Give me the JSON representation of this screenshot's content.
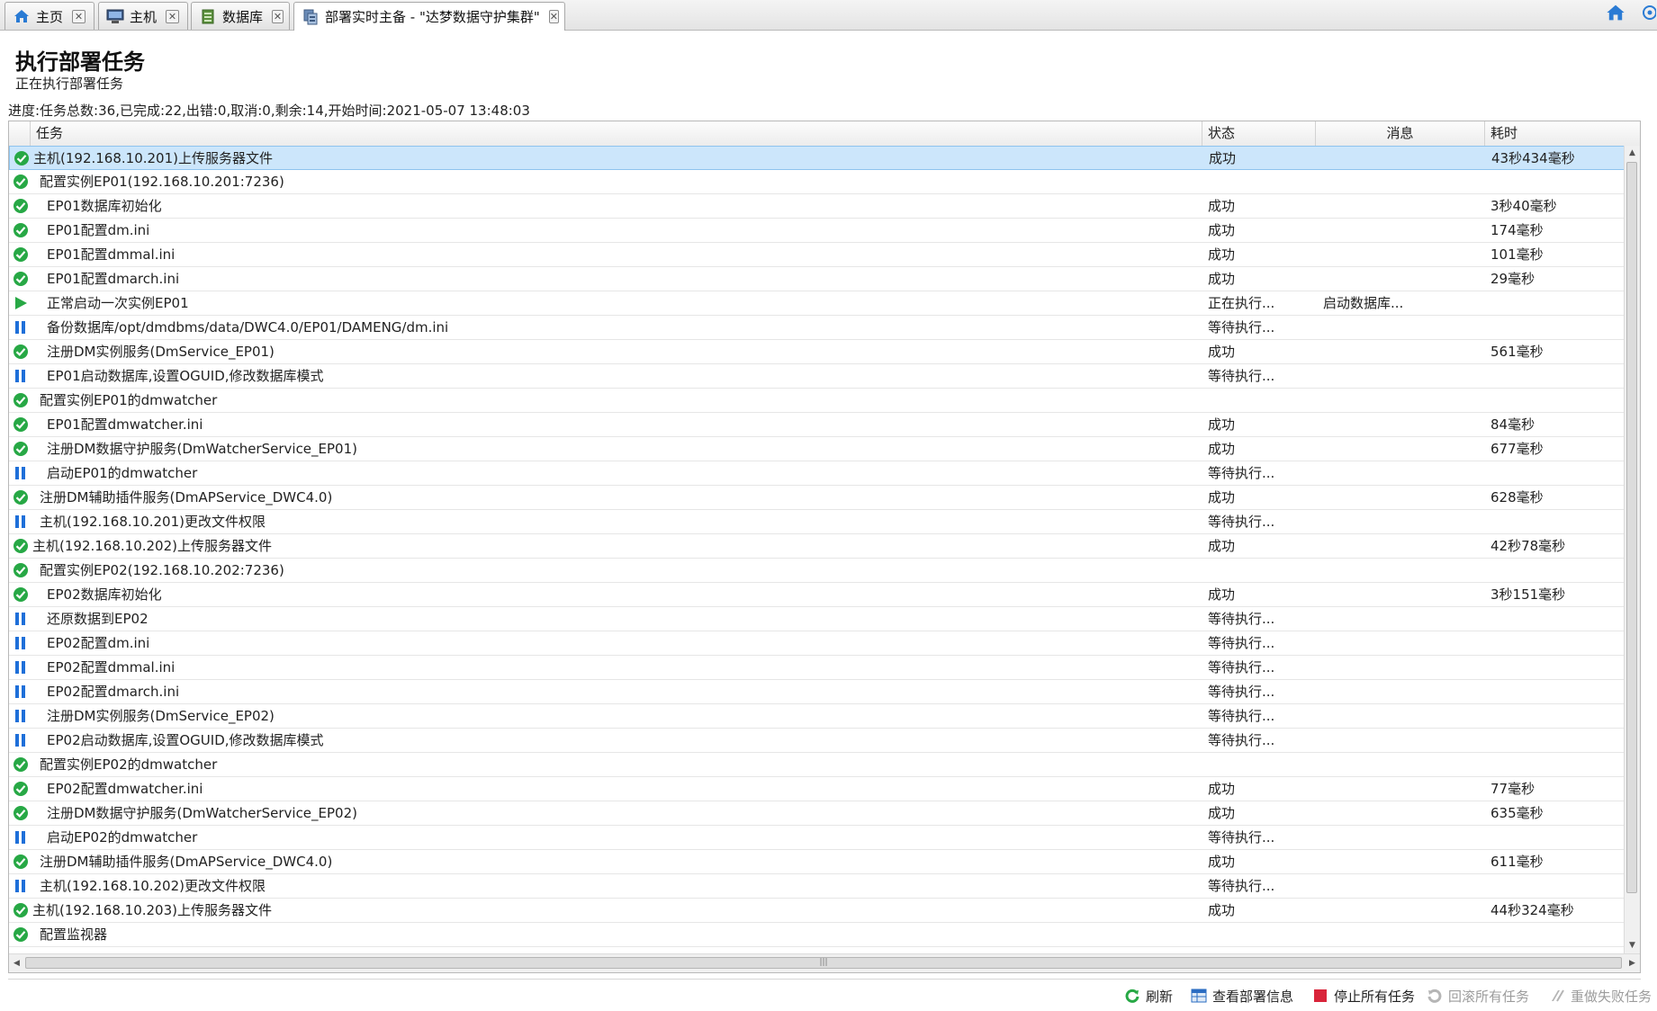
{
  "tabs": [
    {
      "label": "主页",
      "icon": "home-icon"
    },
    {
      "label": "主机",
      "icon": "host-icon"
    },
    {
      "label": "数据库",
      "icon": "database-icon"
    },
    {
      "label": "部署实时主备 - \"达梦数据守护集群\"",
      "icon": "deploy-icon"
    }
  ],
  "header": {
    "title": "执行部署任务",
    "subtitle": "正在执行部署任务",
    "progress": "进度:任务总数:36,已完成:22,出错:0,取消:0,剩余:14,开始时间:2021-05-07 13:48:03"
  },
  "columns": {
    "task": "任务",
    "status": "状态",
    "message": "消息",
    "elapsed": "耗时"
  },
  "rows": [
    {
      "icon": "check",
      "indent": 0,
      "task": "主机(192.168.10.201)上传服务器文件",
      "status": "成功",
      "message": "",
      "elapsed": "43秒434毫秒"
    },
    {
      "icon": "check",
      "indent": 1,
      "task": "配置实例EP01(192.168.10.201:7236)",
      "status": "",
      "message": "",
      "elapsed": ""
    },
    {
      "icon": "check",
      "indent": 2,
      "task": "EP01数据库初始化",
      "status": "成功",
      "message": "",
      "elapsed": "3秒40毫秒"
    },
    {
      "icon": "check",
      "indent": 2,
      "task": "EP01配置dm.ini",
      "status": "成功",
      "message": "",
      "elapsed": "174毫秒"
    },
    {
      "icon": "check",
      "indent": 2,
      "task": "EP01配置dmmal.ini",
      "status": "成功",
      "message": "",
      "elapsed": "101毫秒"
    },
    {
      "icon": "check",
      "indent": 2,
      "task": "EP01配置dmarch.ini",
      "status": "成功",
      "message": "",
      "elapsed": "29毫秒"
    },
    {
      "icon": "play",
      "indent": 2,
      "task": "正常启动一次实例EP01",
      "status": "正在执行...",
      "message": "启动数据库...",
      "elapsed": ""
    },
    {
      "icon": "pause",
      "indent": 2,
      "task": "备份数据库/opt/dmdbms/data/DWC4.0/EP01/DAMENG/dm.ini",
      "status": "等待执行...",
      "message": "",
      "elapsed": ""
    },
    {
      "icon": "check",
      "indent": 2,
      "task": "注册DM实例服务(DmService_EP01)",
      "status": "成功",
      "message": "",
      "elapsed": "561毫秒"
    },
    {
      "icon": "pause",
      "indent": 2,
      "task": "EP01启动数据库,设置OGUID,修改数据库模式",
      "status": "等待执行...",
      "message": "",
      "elapsed": ""
    },
    {
      "icon": "check",
      "indent": 1,
      "task": "配置实例EP01的dmwatcher",
      "status": "",
      "message": "",
      "elapsed": ""
    },
    {
      "icon": "check",
      "indent": 2,
      "task": "EP01配置dmwatcher.ini",
      "status": "成功",
      "message": "",
      "elapsed": "84毫秒"
    },
    {
      "icon": "check",
      "indent": 2,
      "task": "注册DM数据守护服务(DmWatcherService_EP01)",
      "status": "成功",
      "message": "",
      "elapsed": "677毫秒"
    },
    {
      "icon": "pause",
      "indent": 2,
      "task": "启动EP01的dmwatcher",
      "status": "等待执行...",
      "message": "",
      "elapsed": ""
    },
    {
      "icon": "check",
      "indent": 1,
      "task": "注册DM辅助插件服务(DmAPService_DWC4.0)",
      "status": "成功",
      "message": "",
      "elapsed": "628毫秒"
    },
    {
      "icon": "pause",
      "indent": 1,
      "task": "主机(192.168.10.201)更改文件权限",
      "status": "等待执行...",
      "message": "",
      "elapsed": ""
    },
    {
      "icon": "check",
      "indent": 0,
      "task": "主机(192.168.10.202)上传服务器文件",
      "status": "成功",
      "message": "",
      "elapsed": "42秒78毫秒"
    },
    {
      "icon": "check",
      "indent": 1,
      "task": "配置实例EP02(192.168.10.202:7236)",
      "status": "",
      "message": "",
      "elapsed": ""
    },
    {
      "icon": "check",
      "indent": 2,
      "task": "EP02数据库初始化",
      "status": "成功",
      "message": "",
      "elapsed": "3秒151毫秒"
    },
    {
      "icon": "pause",
      "indent": 2,
      "task": "还原数据到EP02",
      "status": "等待执行...",
      "message": "",
      "elapsed": ""
    },
    {
      "icon": "pause",
      "indent": 2,
      "task": "EP02配置dm.ini",
      "status": "等待执行...",
      "message": "",
      "elapsed": ""
    },
    {
      "icon": "pause",
      "indent": 2,
      "task": "EP02配置dmmal.ini",
      "status": "等待执行...",
      "message": "",
      "elapsed": ""
    },
    {
      "icon": "pause",
      "indent": 2,
      "task": "EP02配置dmarch.ini",
      "status": "等待执行...",
      "message": "",
      "elapsed": ""
    },
    {
      "icon": "pause",
      "indent": 2,
      "task": "注册DM实例服务(DmService_EP02)",
      "status": "等待执行...",
      "message": "",
      "elapsed": ""
    },
    {
      "icon": "pause",
      "indent": 2,
      "task": "EP02启动数据库,设置OGUID,修改数据库模式",
      "status": "等待执行...",
      "message": "",
      "elapsed": ""
    },
    {
      "icon": "check",
      "indent": 1,
      "task": "配置实例EP02的dmwatcher",
      "status": "",
      "message": "",
      "elapsed": ""
    },
    {
      "icon": "check",
      "indent": 2,
      "task": "EP02配置dmwatcher.ini",
      "status": "成功",
      "message": "",
      "elapsed": "77毫秒"
    },
    {
      "icon": "check",
      "indent": 2,
      "task": "注册DM数据守护服务(DmWatcherService_EP02)",
      "status": "成功",
      "message": "",
      "elapsed": "635毫秒"
    },
    {
      "icon": "pause",
      "indent": 2,
      "task": "启动EP02的dmwatcher",
      "status": "等待执行...",
      "message": "",
      "elapsed": ""
    },
    {
      "icon": "check",
      "indent": 1,
      "task": "注册DM辅助插件服务(DmAPService_DWC4.0)",
      "status": "成功",
      "message": "",
      "elapsed": "611毫秒"
    },
    {
      "icon": "pause",
      "indent": 1,
      "task": "主机(192.168.10.202)更改文件权限",
      "status": "等待执行...",
      "message": "",
      "elapsed": ""
    },
    {
      "icon": "check",
      "indent": 0,
      "task": "主机(192.168.10.203)上传服务器文件",
      "status": "成功",
      "message": "",
      "elapsed": "44秒324毫秒"
    },
    {
      "icon": "check",
      "indent": 1,
      "task": "配置监视器",
      "status": "",
      "message": "",
      "elapsed": ""
    }
  ],
  "toolbar": {
    "refresh": "刷新",
    "view_info": "查看部署信息",
    "stop_all": "停止所有任务",
    "rollback_all": "回滚所有任务",
    "redo_failed": "重做失败任务"
  },
  "colors": {
    "success_green": "#27a845",
    "pending_blue": "#1e6fd9",
    "stop_red": "#d9243a",
    "selected_row": "#cce6fb",
    "home_blue": "#2a7bd4"
  }
}
